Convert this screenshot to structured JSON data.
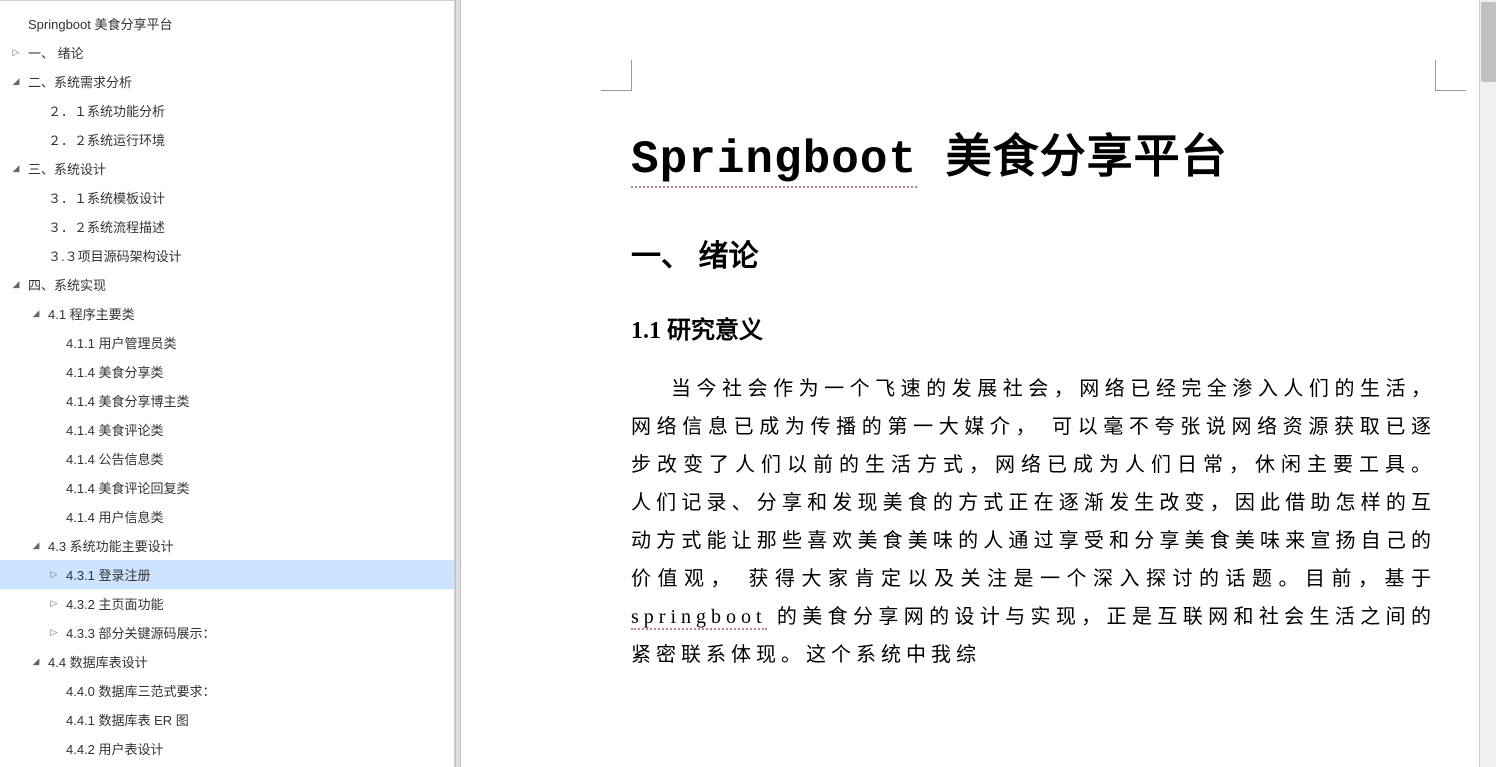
{
  "outline": [
    {
      "label": "Springboot 美食分享平台",
      "indent": 0,
      "twisty": "blank",
      "selected": false
    },
    {
      "label": "一、 绪论",
      "indent": 1,
      "twisty": "right",
      "selected": false
    },
    {
      "label": "二、系统需求分析",
      "indent": 1,
      "twisty": "down",
      "selected": false
    },
    {
      "label": "２．１系统功能分析",
      "indent": 2,
      "twisty": "blank",
      "selected": false
    },
    {
      "label": "２．２系统运行环境",
      "indent": 2,
      "twisty": "blank",
      "selected": false
    },
    {
      "label": "三、系统设计",
      "indent": 1,
      "twisty": "down",
      "selected": false
    },
    {
      "label": "３．１系统模板设计",
      "indent": 2,
      "twisty": "blank",
      "selected": false
    },
    {
      "label": "３．２系统流程描述",
      "indent": 2,
      "twisty": "blank",
      "selected": false
    },
    {
      "label": "３.３项目源码架构设计",
      "indent": 2,
      "twisty": "blank",
      "selected": false
    },
    {
      "label": "四、系统实现",
      "indent": 1,
      "twisty": "down",
      "selected": false
    },
    {
      "label": "4.1  程序主要类",
      "indent": 2,
      "twisty": "down",
      "selected": false
    },
    {
      "label": "4.1.1 用户管理员类",
      "indent": 3,
      "twisty": "blank",
      "selected": false
    },
    {
      "label": "4.1.4 美食分享类",
      "indent": 3,
      "twisty": "blank",
      "selected": false
    },
    {
      "label": "4.1.4 美食分享博主类",
      "indent": 3,
      "twisty": "blank",
      "selected": false
    },
    {
      "label": "4.1.4 美食评论类",
      "indent": 3,
      "twisty": "blank",
      "selected": false
    },
    {
      "label": "4.1.4 公告信息类",
      "indent": 3,
      "twisty": "blank",
      "selected": false
    },
    {
      "label": "4.1.4 美食评论回复类",
      "indent": 3,
      "twisty": "blank",
      "selected": false
    },
    {
      "label": "4.1.4 用户信息类",
      "indent": 3,
      "twisty": "blank",
      "selected": false
    },
    {
      "label": "4.3 系统功能主要设计",
      "indent": 2,
      "twisty": "down",
      "selected": false
    },
    {
      "label": "4.3.1 登录注册",
      "indent": 3,
      "twisty": "right",
      "selected": true
    },
    {
      "label": "4.3.2  主页面功能",
      "indent": 3,
      "twisty": "right",
      "selected": false
    },
    {
      "label": "4.3.3 部分关键源码展示：",
      "indent": 3,
      "twisty": "right",
      "selected": false
    },
    {
      "label": "4.4 数据库表设计",
      "indent": 2,
      "twisty": "down",
      "selected": false
    },
    {
      "label": "4.4.0 数据库三范式要求：",
      "indent": 3,
      "twisty": "blank",
      "selected": false
    },
    {
      "label": "4.4.1 数据库表 ER 图",
      "indent": 3,
      "twisty": "blank",
      "selected": false
    },
    {
      "label": "4.4.2 用户表设计",
      "indent": 3,
      "twisty": "blank",
      "selected": false
    }
  ],
  "doc": {
    "title_first": "Springboot",
    "title_rest": " 美食分享平台",
    "h1": "一、 绪论",
    "h2": "1.1 研究意义",
    "para_pre": "当今社会作为一个飞速的发展社会，网络已经完全渗入人们的生活， 网络信息已成为传播的第一大媒介， 可以毫不夸张说网络资源获取已逐步改变了人们以前的生活方式，网络已成为人们日常，休闲主要工具。 人们记录、分享和发现美食的方式正在逐渐发生改变，因此借助怎样的互动方式能让那些喜欢美食美味的人通过享受和分享美食美味来宣扬自己的价值观， 获得大家肯定以及关注是一个深入探讨的话题。目前，基于 ",
    "para_sb": "springboot",
    "para_post": " 的美食分享网的设计与实现，正是互联网和社会生活之间的紧密联系体现。这个系统中我综"
  }
}
